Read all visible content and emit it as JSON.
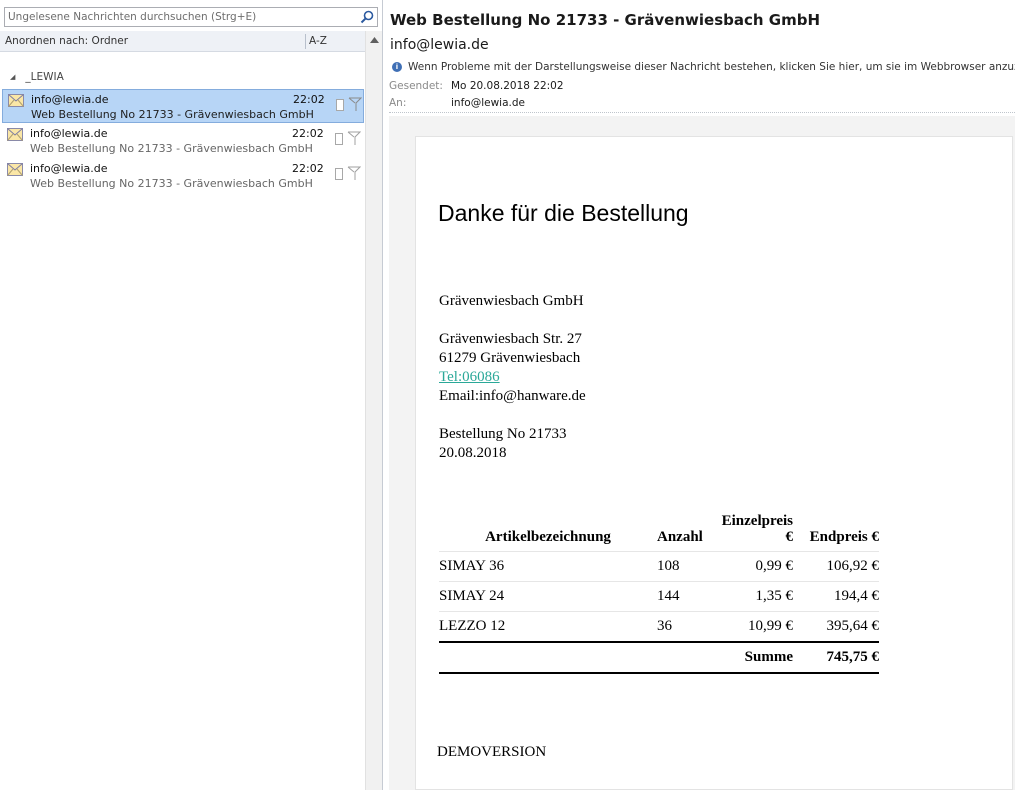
{
  "search": {
    "placeholder": "Ungelesene Nachrichten durchsuchen (Strg+E)"
  },
  "arrange": {
    "label": "Anordnen nach: Ordner",
    "order": "A-Z"
  },
  "group": {
    "name": "_LEWIA"
  },
  "messages": [
    {
      "sender": "info@lewia.de",
      "time": "22:02",
      "subject": "Web Bestellung No 21733 - Grävenwiesbach GmbH",
      "selected": true
    },
    {
      "sender": "info@lewia.de",
      "time": "22:02",
      "subject": "Web Bestellung No 21733 - Grävenwiesbach GmbH",
      "selected": false
    },
    {
      "sender": "info@lewia.de",
      "time": "22:02",
      "subject": "Web Bestellung No 21733 - Grävenwiesbach GmbH",
      "selected": false
    }
  ],
  "reading": {
    "subject": "Web Bestellung No 21733 - Grävenwiesbach GmbH",
    "from": "info@lewia.de",
    "info": "Wenn Probleme mit der Darstellungsweise dieser Nachricht bestehen, klicken Sie hier, um sie im Webbrowser anzuzeigen.",
    "sent_label": "Gesendet:",
    "sent_value": "Mo 20.08.2018 22:02",
    "to_label": "An:",
    "to_value": "info@lewia.de"
  },
  "email_body": {
    "heading": "Danke für die Bestellung",
    "company": "Grävenwiesbach GmbH",
    "street": "Grävenwiesbach Str. 27",
    "city": "61279 Grävenwiesbach",
    "tel": "Tel:06086",
    "email": "Email:info@hanware.de",
    "order_no": "Bestellung No 21733",
    "order_date": "20.08.2018",
    "table": {
      "headers": [
        "Artikelbezeichnung",
        "Anzahl",
        "Einzelpreis €",
        "Endpreis €"
      ],
      "rows": [
        {
          "name": "SIMAY 36",
          "qty": "108",
          "unit": "0,99 €",
          "total": "106,92 €"
        },
        {
          "name": "SIMAY 24",
          "qty": "144",
          "unit": "1,35 €",
          "total": "194,4 €"
        },
        {
          "name": "LEZZO 12",
          "qty": "36",
          "unit": "10,99 €",
          "total": "395,64 €"
        }
      ],
      "sum_label": "Summe",
      "sum_value": "745,75 €"
    },
    "footer": "DEMOVERSION"
  },
  "colors": {
    "selection": "#b7d5f6",
    "link": "#2aa898",
    "info_icon": "#3f6fb5"
  }
}
